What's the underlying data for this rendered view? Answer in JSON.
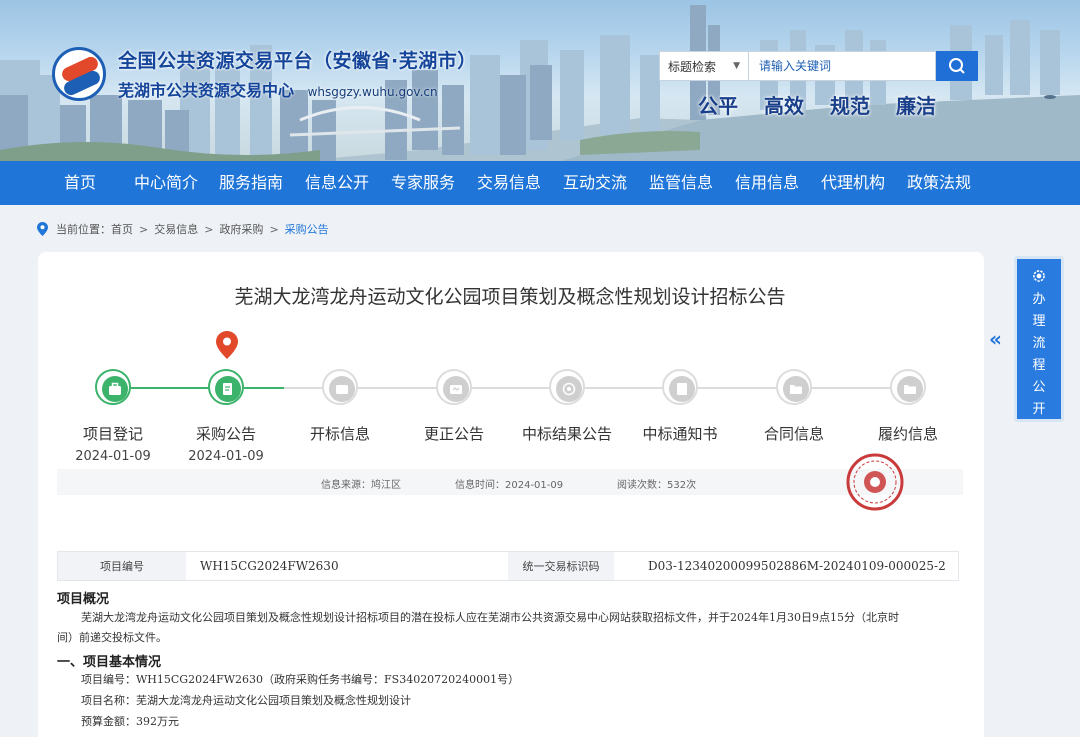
{
  "header": {
    "site_title_1": "全国公共资源交易平台（安徽省·芜湖市）",
    "site_title_2": "芜湖市公共资源交易中心",
    "site_domain": "whsggzy.wuhu.gov.cn",
    "search_scope": "标题检索",
    "search_placeholder": "请输入关键词",
    "slogans": [
      "公平",
      "高效",
      "规范",
      "廉洁"
    ]
  },
  "nav": {
    "items": [
      "首页",
      "中心简介",
      "服务指南",
      "信息公开",
      "专家服务",
      "交易信息",
      "互动交流",
      "监管信息",
      "信用信息",
      "代理机构",
      "政策法规"
    ]
  },
  "breadcrumb": {
    "prefix": "当前位置：",
    "items": [
      "首页",
      "交易信息",
      "政府采购",
      "采购公告"
    ],
    "separator": ">"
  },
  "article": {
    "title": "芜湖大龙湾龙舟运动文化公园项目策划及概念性规划设计招标公告",
    "steps": [
      {
        "label": "项目登记",
        "date": "2024-01-09",
        "status": "done"
      },
      {
        "label": "采购公告",
        "date": "2024-01-09",
        "status": "done"
      },
      {
        "label": "开标信息",
        "date": "",
        "status": "todo"
      },
      {
        "label": "更正公告",
        "date": "",
        "status": "todo"
      },
      {
        "label": "中标结果公告",
        "date": "",
        "status": "todo"
      },
      {
        "label": "中标通知书",
        "date": "",
        "status": "todo"
      },
      {
        "label": "合同信息",
        "date": "",
        "status": "todo"
      },
      {
        "label": "履约信息",
        "date": "",
        "status": "todo"
      }
    ],
    "info": {
      "source": "信息来源：鸠江区",
      "time": "信息时间：2024-01-09",
      "views": "阅读次数：532次"
    },
    "table": {
      "project_no_label": "项目编号",
      "project_no": "WH15CG2024FW2630",
      "trade_code_label": "统一交易标识码",
      "trade_code": "D03-12340200099502886M-20240109-000025-2"
    },
    "overview_heading": "项目概况",
    "overview_text_1": "芜湖大龙湾龙舟运动文化公园项目策划及概念性规划设计招标项目的潜在投标人应在芜湖市公共资源交易中心网站获取招标文件，并于2024年1月30日9点15分（北京时",
    "overview_text_2": "间）前递交投标文件。",
    "section1_heading": "一、项目基本情况",
    "section1_lines": [
      "项目编号：WH15CG2024FW2630（政府采购任务书编号：FS34020720240001号）",
      "项目名称：芜湖大龙湾龙舟运动文化公园项目策划及概念性规划设计",
      "预算金额：392万元"
    ]
  },
  "side_panel": {
    "chars": [
      "办",
      "理",
      "流",
      "程",
      "公",
      "开"
    ]
  },
  "colors": {
    "primary": "#1f75d8",
    "done_green": "#3bb36b",
    "marker_red": "#e2492b"
  }
}
